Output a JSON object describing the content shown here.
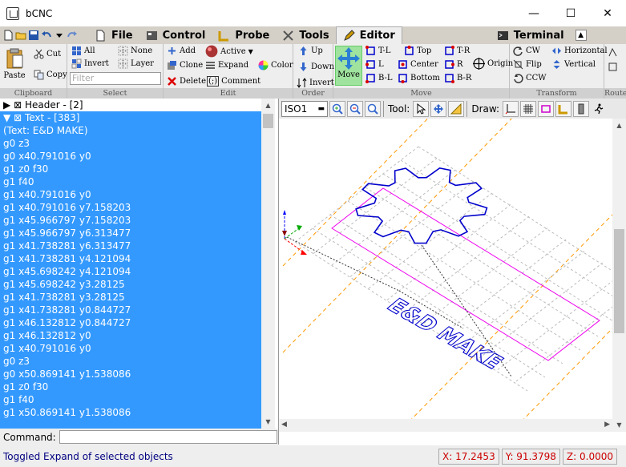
{
  "window": {
    "title": "bCNC",
    "minimize": "—",
    "maximize": "☐",
    "close": "✕"
  },
  "tabs": [
    {
      "label": "File"
    },
    {
      "label": "Control"
    },
    {
      "label": "Probe"
    },
    {
      "label": "Tools"
    },
    {
      "label": "Editor"
    },
    {
      "label": "Terminal"
    }
  ],
  "ribbon": {
    "clipboard": {
      "label": "Clipboard",
      "paste": "Paste",
      "cut": "Cut",
      "copy": "Copy"
    },
    "select": {
      "label": "Select",
      "all": "All",
      "none": "None",
      "invert": "Invert",
      "layer": "Layer",
      "filter_placeholder": "Filter"
    },
    "edit": {
      "label": "Edit",
      "add": "Add",
      "active": "Active",
      "clone": "Clone",
      "expand": "Expand",
      "color": "Color",
      "delete": "Delete",
      "comment": "Comment"
    },
    "order": {
      "label": "Order",
      "up": "Up",
      "down": "Down",
      "invert": "Invert"
    },
    "move": {
      "label": "Move",
      "move": "Move",
      "tl": "T-L",
      "top": "Top",
      "tr": "T-R",
      "l": "L",
      "center": "Center",
      "r": "R",
      "bl": "B-L",
      "bottom": "Bottom",
      "br": "B-R",
      "origin": "Origin"
    },
    "transform": {
      "label": "Transform",
      "cw": "CW",
      "horizontal": "Horizontal",
      "flip": "Flip",
      "vertical": "Vertical",
      "ccw": "CCW"
    },
    "route": {
      "label": "Route"
    }
  },
  "tree": {
    "header": {
      "label": "Header - [2]"
    },
    "text": {
      "label": "Text - [383]"
    }
  },
  "gcode_lines": [
    "(Text: E&D MAKE)",
    "g0 z3",
    "g0 x40.791016 y0",
    "g1 z0 f30",
    "g1 f40",
    "g1 x40.791016 y0",
    "g1 x40.791016 y7.158203",
    "g1 x45.966797 y7.158203",
    "g1 x45.966797 y6.313477",
    "g1 x41.738281 y6.313477",
    "g1 x41.738281 y4.121094",
    "g1 x45.698242 y4.121094",
    "g1 x45.698242 y3.28125",
    "g1 x41.738281 y3.28125",
    "g1 x41.738281 y0.844727",
    "g1 x46.132812 y0.844727",
    "g1 x46.132812 y0",
    "g1 x40.791016 y0",
    "g0 z3",
    "g0 x50.869141 y1.538086",
    "g1 z0 f30",
    "g1 f40",
    "g1 x50.869141 y1.538086"
  ],
  "canvas_toolbar": {
    "view": "ISO1",
    "tool_label": "Tool:",
    "draw_label": "Draw:"
  },
  "canvas": {
    "text": "E&D MAKE",
    "gear_color": "#0000cc",
    "margin_color": "#ff00ff",
    "limit_color": "#ff9900"
  },
  "command": {
    "label": "Command:"
  },
  "status": {
    "message": "Toggled Expand of selected objects",
    "x": "X: 17.2453",
    "y": "Y: 91.3798",
    "z": "Z: 0.0000"
  }
}
